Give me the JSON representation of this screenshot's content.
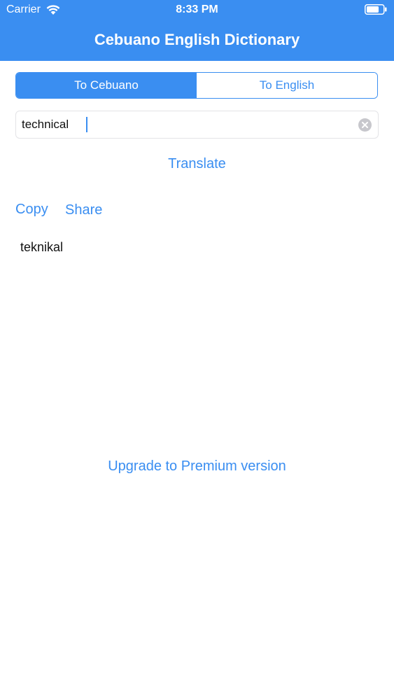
{
  "status_bar": {
    "carrier": "Carrier",
    "time": "8:33 PM",
    "wifi_icon": "wifi-icon",
    "battery_icon": "battery-icon"
  },
  "header": {
    "title": "Cebuano English Dictionary"
  },
  "segmented_control": {
    "options": [
      {
        "label": "To Cebuano",
        "selected": true
      },
      {
        "label": "To English",
        "selected": false
      }
    ]
  },
  "search": {
    "value": "technical",
    "clear_icon": "clear-icon"
  },
  "actions": {
    "translate_label": "Translate",
    "copy_label": "Copy",
    "share_label": "Share"
  },
  "result": {
    "text": "teknikal"
  },
  "footer": {
    "upgrade_label": "Upgrade to Premium version"
  },
  "colors": {
    "accent": "#3a8ef1",
    "header_text": "#ffffff",
    "body_text": "#111111"
  }
}
